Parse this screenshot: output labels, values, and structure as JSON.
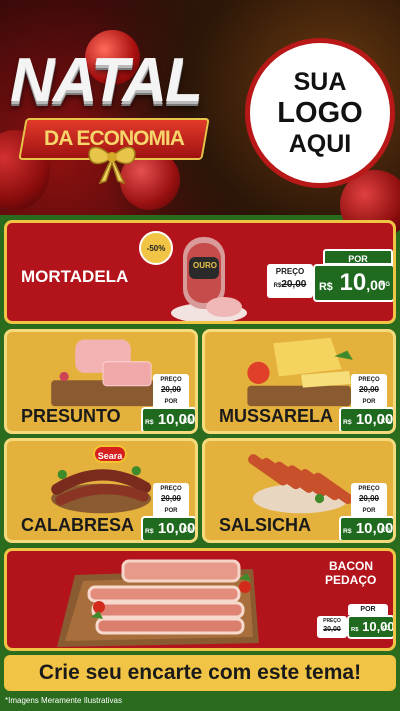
{
  "header": {
    "title": "NATAL",
    "subtitle": "DA ECONOMIA",
    "logo_lines": [
      "SUA",
      "LOGO",
      "AQUI"
    ]
  },
  "price_labels": {
    "preco": "PREÇO",
    "por": "POR",
    "currency": "R$",
    "unit": "KG"
  },
  "featured": {
    "name": "MORTADELA",
    "discount_badge": "-50%",
    "brand_label": "OURO",
    "old_price": "20,00",
    "new_price_int": "10",
    "new_price_dec": ",00"
  },
  "products": [
    {
      "name": "PRESUNTO",
      "old_price": "20,00",
      "new_price": "10,00"
    },
    {
      "name": "MUSSARELA",
      "old_price": "20,00",
      "new_price": "10,00"
    },
    {
      "name": "CALABRESA",
      "old_price": "20,00",
      "new_price": "10,00",
      "brand_label": "Seara"
    },
    {
      "name": "SALSICHA",
      "old_price": "20,00",
      "new_price": "10,00"
    }
  ],
  "bacon": {
    "name_line1": "BACON",
    "name_line2": "PEDAÇO",
    "old_price": "20,00",
    "new_price": "10,00"
  },
  "cta": "Crie seu encarte com este tema!",
  "footnote": "*Imagens Meramente Ilustrativas",
  "colors": {
    "red": "#b3141c",
    "gold": "#e3b13c",
    "green": "#1f6a1f",
    "border": "#f0c545"
  }
}
